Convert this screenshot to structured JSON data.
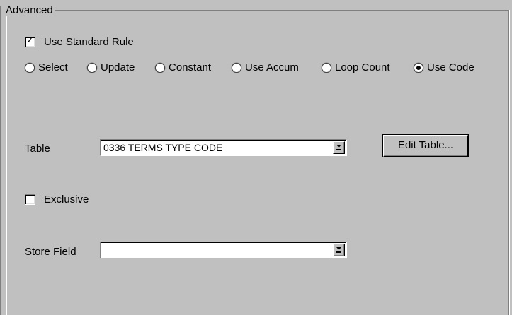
{
  "group": {
    "title": "Advanced"
  },
  "use_standard_rule": {
    "label": "Use Standard Rule",
    "checked": true
  },
  "radios": [
    {
      "label": "Select",
      "selected": false
    },
    {
      "label": "Update",
      "selected": false
    },
    {
      "label": "Constant",
      "selected": false
    },
    {
      "label": "Use Accum",
      "selected": false
    },
    {
      "label": "Loop Count",
      "selected": false
    },
    {
      "label": "Use Code",
      "selected": true
    }
  ],
  "table": {
    "label": "Table",
    "value": "0336 TERMS TYPE CODE"
  },
  "edit_table_button": {
    "label": "Edit Table..."
  },
  "exclusive": {
    "label": "Exclusive",
    "checked": false
  },
  "store_field": {
    "label": "Store Field",
    "value": ""
  },
  "colors": {
    "face": "#c0c0c0",
    "window": "#ffffff",
    "shadow": "#808080"
  }
}
